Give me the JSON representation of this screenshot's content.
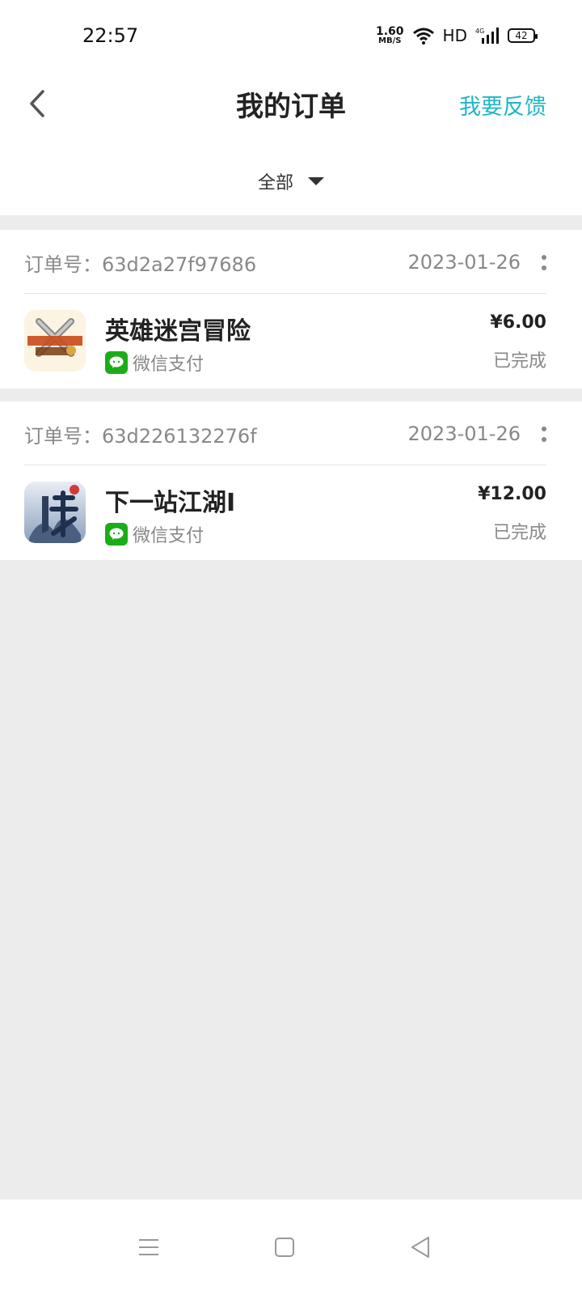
{
  "status_bar": {
    "time": "22:57",
    "net_speed_value": "1.60",
    "net_speed_unit": "MB/S",
    "hd": "HD",
    "network": "4G",
    "battery": "42"
  },
  "header": {
    "title": "我的订单",
    "feedback": "我要反馈",
    "filter": "全部"
  },
  "orders": [
    {
      "order_no": "订单号：63d2a27f97686",
      "date": "2023-01-26",
      "game": "英雄迷宫冒险",
      "payment": "微信支付",
      "price": "¥6.00",
      "status": "已完成",
      "icon": "game-icon-weapon-shop-fantasy"
    },
    {
      "order_no": "订单号：63d226132276f",
      "date": "2023-01-26",
      "game": "下一站江湖Ⅰ",
      "payment": "微信支付",
      "price": "¥12.00",
      "status": "已完成",
      "icon": "game-icon-xia"
    }
  ],
  "colors": {
    "accent": "#1fb6c6",
    "wechat": "#1aad19",
    "page_bg": "#ececec"
  }
}
